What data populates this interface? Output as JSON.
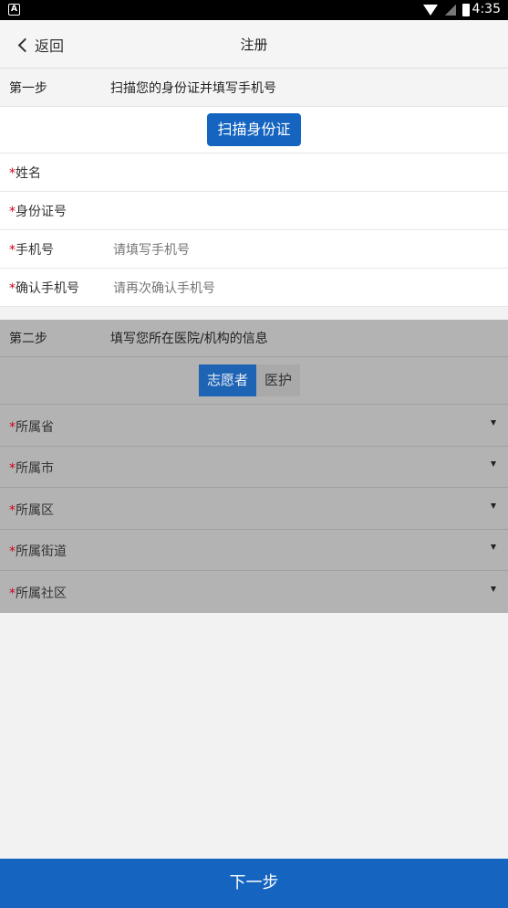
{
  "status_bar": {
    "app_icon_text": "A",
    "time": "4:35"
  },
  "nav": {
    "back_label": "返回",
    "title": "注册"
  },
  "step1": {
    "label": "第一步",
    "desc": "扫描您的身份证并填写手机号",
    "scan_button": "扫描身份证",
    "fields": [
      {
        "required_mark": "*",
        "label": "姓名",
        "value": "",
        "placeholder": ""
      },
      {
        "required_mark": "*",
        "label": "身份证号",
        "value": "",
        "placeholder": ""
      },
      {
        "required_mark": "*",
        "label": "手机号",
        "value": "",
        "placeholder": "请填写手机号"
      },
      {
        "required_mark": "*",
        "label": "确认手机号",
        "value": "",
        "placeholder": "请再次确认手机号"
      }
    ]
  },
  "step2": {
    "label": "第二步",
    "desc": "填写您所在医院/机构的信息",
    "segments": [
      {
        "label": "志愿者",
        "selected": true
      },
      {
        "label": "医护",
        "selected": false
      }
    ],
    "dropdowns": [
      {
        "required_mark": "*",
        "label": "所属省",
        "value": ""
      },
      {
        "required_mark": "*",
        "label": "所属市",
        "value": ""
      },
      {
        "required_mark": "*",
        "label": "所属区",
        "value": ""
      },
      {
        "required_mark": "*",
        "label": "所属街道",
        "value": ""
      },
      {
        "required_mark": "*",
        "label": "所属社区",
        "value": ""
      }
    ]
  },
  "next_button": "下一步",
  "colors": {
    "primary": "#1565c0",
    "required": "#d0021b",
    "overlay": "#b3b3b3"
  }
}
